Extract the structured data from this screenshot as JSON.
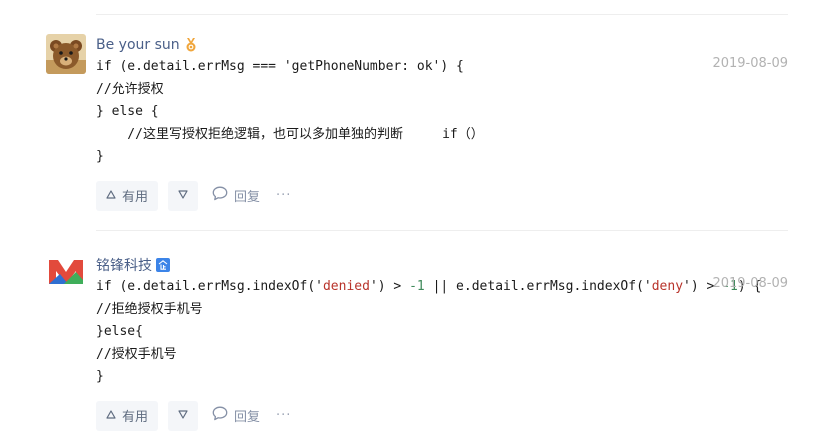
{
  "comments": [
    {
      "author": "Be your sun",
      "date": "2019-08-09",
      "lines": [
        [
          {
            "t": "if (e.detail.errMsg === 'getPhoneNumber: ok') {"
          }
        ],
        [
          {
            "t": "//允许授权"
          }
        ],
        [
          {
            "t": "} else {"
          }
        ],
        [
          {
            "t": "    //这里写授权拒绝逻辑，也可以多加单独的判断     if（）"
          }
        ],
        [
          {
            "t": "}"
          }
        ]
      ],
      "actions": {
        "like": "有用",
        "reply": "回复",
        "more": "···"
      }
    },
    {
      "author": "铭锋科技",
      "date": "2019-08-09",
      "lines": [
        [
          {
            "t": "if (e.detail.errMsg.indexOf('"
          },
          {
            "t": "denied",
            "c": "str"
          },
          {
            "t": "') > "
          },
          {
            "t": "-1",
            "c": "num"
          },
          {
            "t": " || e.detail.errMsg.indexOf('"
          },
          {
            "t": "deny",
            "c": "str"
          },
          {
            "t": "') > "
          },
          {
            "t": "-1",
            "c": "num"
          },
          {
            "t": ") {"
          }
        ],
        [
          {
            "t": "//拒绝授权手机号"
          }
        ],
        [
          {
            "t": "}else{"
          }
        ],
        [
          {
            "t": "//授权手机号"
          }
        ],
        [
          {
            "t": "}"
          }
        ]
      ],
      "actions": {
        "like": "有用",
        "reply": "回复",
        "more": "···"
      }
    }
  ],
  "icons": {
    "medal": "medal-icon",
    "verified": "enterprise-verified-icon",
    "like": "triangle-up-icon",
    "dislike": "triangle-down-icon",
    "reply": "speech-bubble-icon"
  },
  "colors": {
    "author": "#4a5f88",
    "date": "#b2b2b2",
    "string": "#b8332a",
    "number": "#3f8a5b",
    "button_bg": "#f4f6f9",
    "medal": "#f0a63c",
    "verified": "#3c84e8"
  }
}
